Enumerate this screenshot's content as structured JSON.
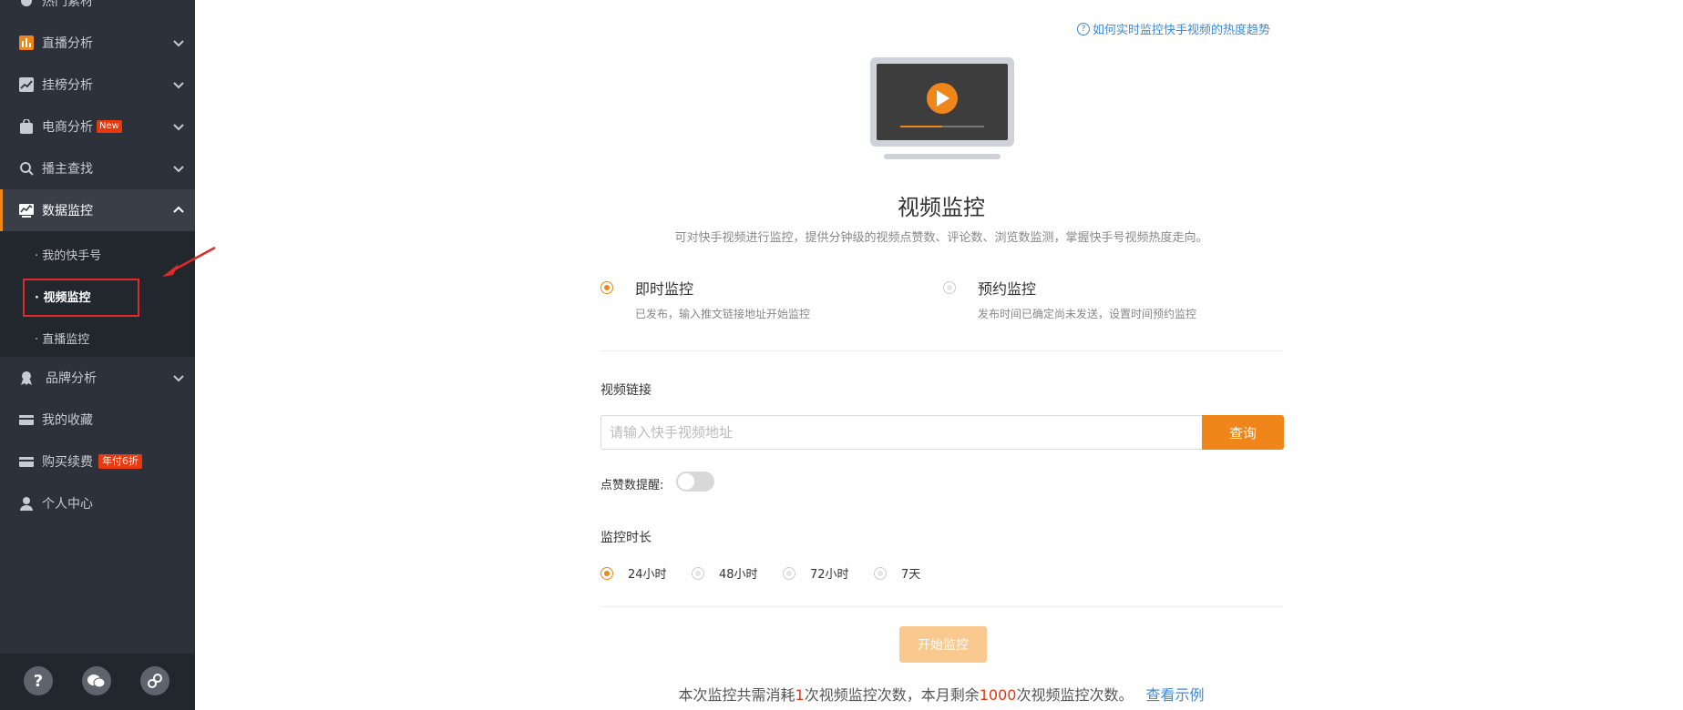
{
  "sidebar": {
    "items": [
      {
        "label": "热门素材"
      },
      {
        "label": "直播分析"
      },
      {
        "label": "挂榜分析"
      },
      {
        "label": "电商分析",
        "badge": "New"
      },
      {
        "label": "播主查找"
      },
      {
        "label": "数据监控"
      },
      {
        "label": "品牌分析"
      },
      {
        "label": "我的收藏"
      },
      {
        "label": "购买续费",
        "badge": "年付6折"
      },
      {
        "label": "个人中心"
      }
    ],
    "submenu": [
      {
        "label": "· 我的快手号"
      },
      {
        "label": "· 视频监控"
      },
      {
        "label": "· 直播监控"
      }
    ]
  },
  "main": {
    "help_link": "如何实时监控快手视频的热度趋势",
    "title": "视频监控",
    "description": "可对快手视频进行监控，提供分钟级的视频点赞数、评论数、浏览数监测，掌握快手号视频热度走向。",
    "modes": [
      {
        "title": "即时监控",
        "subtitle": "已发布，输入推文链接地址开始监控"
      },
      {
        "title": "预约监控",
        "subtitle": "发布时间已确定尚未发送，设置时间预约监控"
      }
    ],
    "link_label": "视频链接",
    "link_placeholder": "请输入快手视频地址",
    "query_button": "查询",
    "like_reminder_label": "点赞数提醒:",
    "duration_label": "监控时长",
    "durations": [
      "24小时",
      "48小时",
      "72小时",
      "7天"
    ],
    "start_button": "开始监控",
    "footer": {
      "part1": "本次监控共需消耗",
      "cost": "1",
      "part2": "次视频监控次数，本月剩余",
      "remaining": "1000",
      "part3": "次视频监控次数。",
      "example_link": "查看示例"
    }
  },
  "colors": {
    "accent": "#f08519",
    "sidebar_bg": "#2d3139",
    "link": "#3e89d8",
    "highlight": "#e02a2a"
  }
}
